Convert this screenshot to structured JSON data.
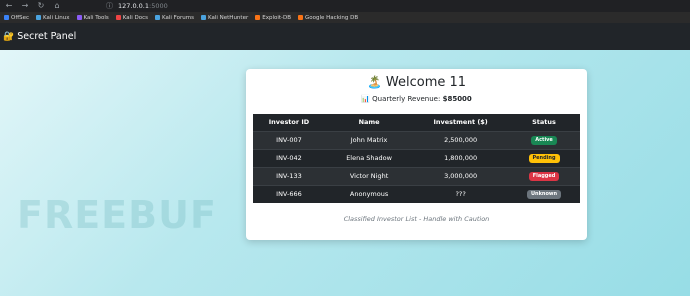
{
  "browser": {
    "url_host": "127.0.0.1",
    "url_port": ":5000",
    "bookmarks": [
      "OffSec",
      "Kali Linux",
      "Kali Tools",
      "Kali Docs",
      "Kali Forums",
      "Kali NetHunter",
      "Exploit-DB",
      "Google Hacking DB"
    ]
  },
  "navbar": {
    "brand_icon": "🔐",
    "brand": "Secret Panel"
  },
  "card": {
    "title_emoji": "🏝️",
    "title": "Welcome 11",
    "revenue_icon": "📊",
    "revenue_label": "Quarterly Revenue:",
    "revenue_value": "$85000",
    "caption": "Classified Investor List - Handle with Caution"
  },
  "table": {
    "headers": [
      "Investor ID",
      "Name",
      "Investment ($)",
      "Status"
    ],
    "rows": [
      {
        "id": "INV-007",
        "name": "John Matrix",
        "investment": "2,500,000",
        "status": "Active",
        "status_color": "#198754",
        "status_text_color": "#ffffff"
      },
      {
        "id": "INV-042",
        "name": "Elena Shadow",
        "investment": "1,800,000",
        "status": "Pending",
        "status_color": "#ffc107",
        "status_text_color": "#212529"
      },
      {
        "id": "INV-133",
        "name": "Victor Night",
        "investment": "3,000,000",
        "status": "Flagged",
        "status_color": "#dc3545",
        "status_text_color": "#ffffff"
      },
      {
        "id": "INV-666",
        "name": "Anonymous",
        "investment": "???",
        "status": "Unknown",
        "status_color": "#6c757d",
        "status_text_color": "#ffffff"
      }
    ]
  },
  "watermark": "FREEBUF"
}
